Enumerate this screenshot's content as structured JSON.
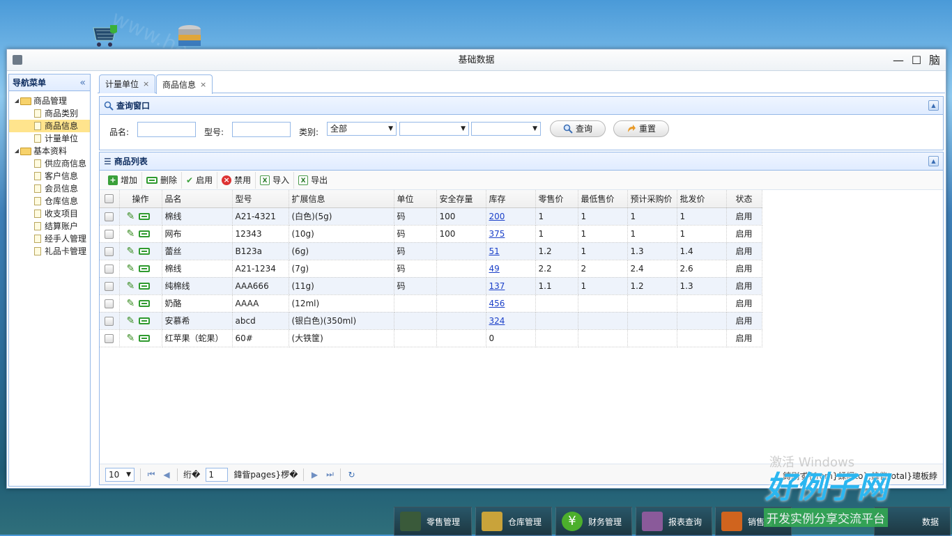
{
  "watermark": "www.haolizi.com",
  "window": {
    "title": "基础数据"
  },
  "titlebar": {
    "min": "—",
    "max": "☐",
    "extra": "脑"
  },
  "sidebar": {
    "title": "导航菜单",
    "collapse": "«",
    "groups": [
      {
        "label": "商品管理",
        "items": [
          "商品类别",
          "商品信息",
          "计量单位"
        ]
      },
      {
        "label": "基本资料",
        "items": [
          "供应商信息",
          "客户信息",
          "会员信息",
          "仓库信息",
          "收支项目",
          "结算账户",
          "经手人管理",
          "礼品卡管理"
        ]
      }
    ],
    "selected": "商品信息"
  },
  "tabs": [
    {
      "label": "计量单位",
      "close": "×"
    },
    {
      "label": "商品信息",
      "close": "×"
    }
  ],
  "query": {
    "title": "查询窗口",
    "name_label": "品名:",
    "name_value": "",
    "model_label": "型号:",
    "model_value": "",
    "category_label": "类别:",
    "category_value": "全部",
    "search_btn": "查询",
    "reset_btn": "重置"
  },
  "list": {
    "title": "商品列表",
    "toolbar": {
      "add": "增加",
      "delete": "删除",
      "enable": "启用",
      "disable": "禁用",
      "import": "导入",
      "export": "导出"
    },
    "columns": [
      "操作",
      "品名",
      "型号",
      "扩展信息",
      "单位",
      "安全存量",
      "库存",
      "零售价",
      "最低售价",
      "预计采购价",
      "批发价",
      "状态"
    ],
    "rows": [
      {
        "name": "棉线",
        "model": "A21-4321",
        "ext": "(白色)(5g)",
        "unit": "码",
        "safe": "100",
        "stock": "200",
        "retail": "1",
        "min": "1",
        "purchase": "1",
        "wholesale": "1",
        "status": "启用",
        "link": true
      },
      {
        "name": "网布",
        "model": "12343",
        "ext": "(10g)",
        "unit": "码",
        "safe": "100",
        "stock": "375",
        "retail": "1",
        "min": "1",
        "purchase": "1",
        "wholesale": "1",
        "status": "启用",
        "link": true
      },
      {
        "name": "蕾丝",
        "model": "B123a",
        "ext": "(6g)",
        "unit": "码",
        "safe": "",
        "stock": "51",
        "retail": "1.2",
        "min": "1",
        "purchase": "1.3",
        "wholesale": "1.4",
        "status": "启用",
        "link": true
      },
      {
        "name": "棉线",
        "model": "A21-1234",
        "ext": "(7g)",
        "unit": "码",
        "safe": "",
        "stock": "49",
        "retail": "2.2",
        "min": "2",
        "purchase": "2.4",
        "wholesale": "2.6",
        "status": "启用",
        "link": true
      },
      {
        "name": "纯棉线",
        "model": "AAA666",
        "ext": "(11g)",
        "unit": "码",
        "safe": "",
        "stock": "137",
        "retail": "1.1",
        "min": "1",
        "purchase": "1.2",
        "wholesale": "1.3",
        "status": "启用",
        "link": true
      },
      {
        "name": "奶酪",
        "model": "AAAA",
        "ext": "(12ml)",
        "unit": "",
        "safe": "",
        "stock": "456",
        "retail": "",
        "min": "",
        "purchase": "",
        "wholesale": "",
        "status": "启用",
        "link": true
      },
      {
        "name": "安慕希",
        "model": "abcd",
        "ext": "(银白色)(350ml)",
        "unit": "",
        "safe": "",
        "stock": "324",
        "retail": "",
        "min": "",
        "purchase": "",
        "wholesale": "",
        "status": "启用",
        "link": true
      },
      {
        "name": "红苹果（蛇果）",
        "model": "60#",
        "ext": "(大铁筐)",
        "unit": "",
        "safe": "",
        "stock": "0",
        "retail": "",
        "min": "",
        "purchase": "",
        "wholesale": "",
        "status": "启用",
        "link": false
      }
    ]
  },
  "pager": {
    "page_size": "10",
    "page_label_pre": "绗�",
    "page_value": "1",
    "page_label_post": "鍏眥pages}椤�",
    "info": "鏄剧ず{from}鍒皗to},鍏眥total}璁板綍"
  },
  "activate": "激活 Windows",
  "desktop": {
    "tasks": [
      "零售管理",
      "仓库管理",
      "财务管理",
      "报表查询",
      "销售管",
      "数据"
    ]
  },
  "logo": {
    "title": "好例子网",
    "sub": "开发实例分享交流平台"
  },
  "colors": {
    "accent": "#95b8e7",
    "header": "#0e2d5f",
    "link": "#1a3fc8",
    "selected": "#ffe48d"
  }
}
